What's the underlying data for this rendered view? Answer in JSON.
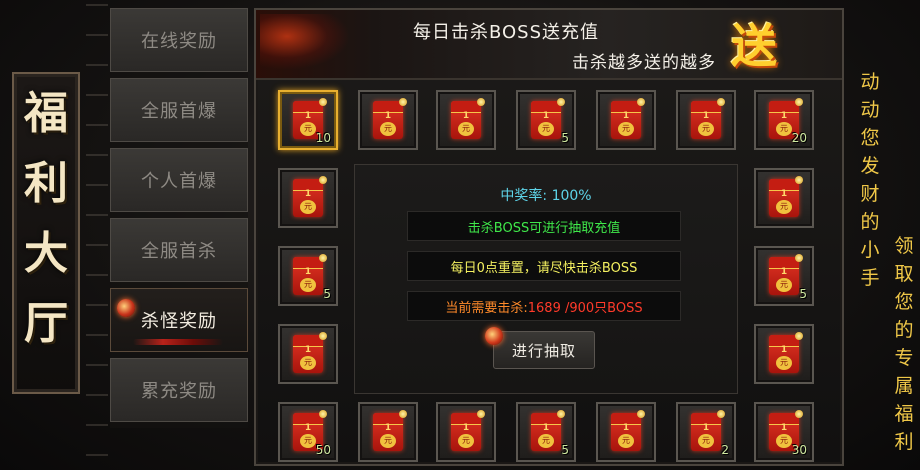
{
  "side_title": [
    "福",
    "利",
    "大",
    "厅"
  ],
  "tabs": [
    {
      "label": "在线奖励",
      "active": false
    },
    {
      "label": "全服首爆",
      "active": false
    },
    {
      "label": "个人首爆",
      "active": false
    },
    {
      "label": "全服首杀",
      "active": false
    },
    {
      "label": "杀怪奖励",
      "active": true
    },
    {
      "label": "累充奖励",
      "active": false
    }
  ],
  "banner": {
    "title": "每日击杀BOSS送充值",
    "subtitle": "击杀越多送的越多",
    "badge": "送"
  },
  "info": {
    "rate_label": "中奖率:",
    "rate_value": "100%",
    "line1": "击杀BOSS可进行抽取充值",
    "line2": "每日0点重置，请尽快击杀BOSS",
    "line3_label": "当前需要击杀:",
    "line3_value": "1689 /900只BOSS",
    "draw_button": "进行抽取"
  },
  "envelope": {
    "amount": "1",
    "unit": "元"
  },
  "rewards": [
    {
      "qty": "10",
      "selected": true
    },
    {
      "qty": "",
      "selected": false
    },
    {
      "qty": "",
      "selected": false
    },
    {
      "qty": "5",
      "selected": false
    },
    {
      "qty": "",
      "selected": false
    },
    {
      "qty": "",
      "selected": false
    },
    {
      "qty": "20",
      "selected": false
    },
    {
      "qty": "",
      "selected": false
    },
    {
      "qty": "",
      "selected": false
    },
    {
      "qty": "5",
      "selected": false
    },
    {
      "qty": "5",
      "selected": false
    },
    {
      "qty": "",
      "selected": false
    },
    {
      "qty": "",
      "selected": false
    },
    {
      "qty": "50",
      "selected": false
    },
    {
      "qty": "",
      "selected": false
    },
    {
      "qty": "",
      "selected": false
    },
    {
      "qty": "5",
      "selected": false
    },
    {
      "qty": "",
      "selected": false
    },
    {
      "qty": "2",
      "selected": false
    },
    {
      "qty": "30",
      "selected": false
    }
  ],
  "right_text": {
    "col1": "动动您发财的小手",
    "col2": "领取您的专属福利"
  }
}
